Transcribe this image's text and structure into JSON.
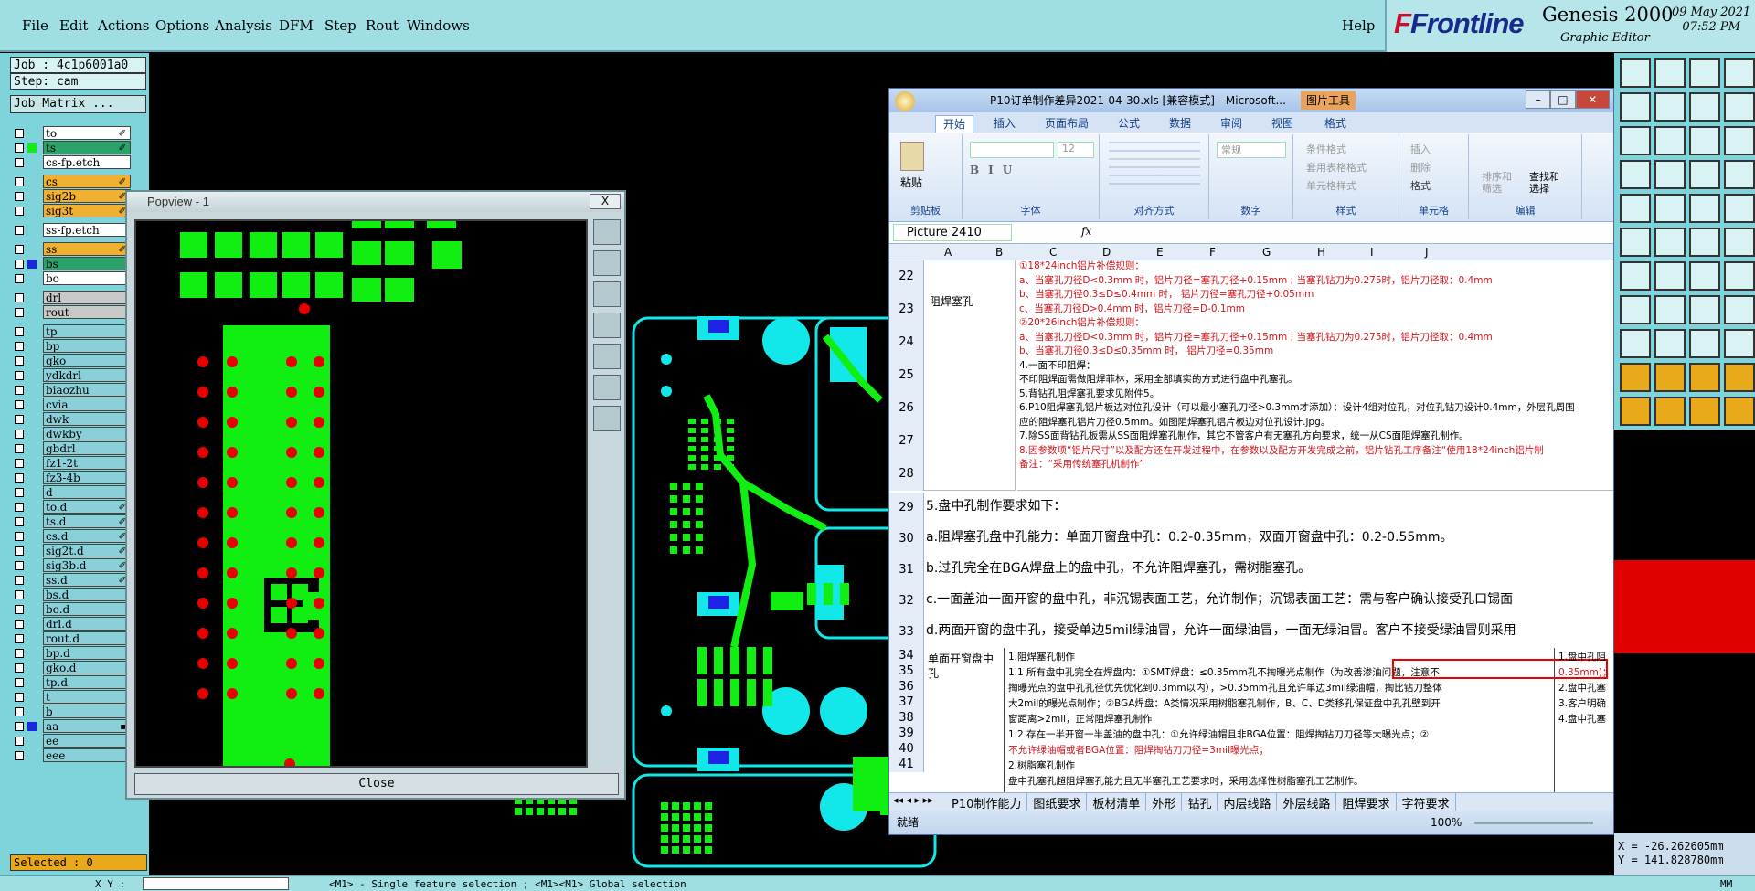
{
  "menu": {
    "items": [
      "File",
      "Edit",
      "Actions",
      "Options",
      "Analysis",
      "DFM",
      "Step",
      "Rout",
      "Windows"
    ],
    "help": "Help"
  },
  "brand": {
    "logo": "Frontline",
    "product": "Genesis 2000",
    "subtitle": "Graphic Editor",
    "date": "09 May 2021",
    "time": "07:52 PM"
  },
  "job": {
    "job_label": "Job : 4c1p6001a0",
    "step_label": "Step: cam",
    "matrix_button": "Job Matrix ..."
  },
  "layers": [
    {
      "name": "to",
      "color": "#ffffff",
      "swatch": "",
      "mark": "✐"
    },
    {
      "name": "ts",
      "color": "#2aa36a",
      "swatch": "#11ee11",
      "mark": "✐"
    },
    {
      "name": "cs-fp.etch",
      "color": "#ffffff",
      "swatch": "",
      "mark": ""
    },
    {
      "name": "cs",
      "color": "#f0b030",
      "swatch": "",
      "mark": "✐"
    },
    {
      "name": "sig2b",
      "color": "#f0b030",
      "swatch": "",
      "mark": "✐"
    },
    {
      "name": "sig3t",
      "color": "#f0b030",
      "swatch": "",
      "mark": "✐"
    },
    {
      "name": "ss-fp.etch",
      "color": "#ffffff",
      "swatch": "",
      "mark": ""
    },
    {
      "name": "ss",
      "color": "#f0b030",
      "swatch": "",
      "mark": "✐"
    },
    {
      "name": "bs",
      "color": "#2aa36a",
      "swatch": "#1a2ad8",
      "mark": ""
    },
    {
      "name": "bo",
      "color": "#ffffff",
      "swatch": "",
      "mark": ""
    },
    {
      "name": "drl",
      "color": "#c8c8c8",
      "swatch": "",
      "mark": ""
    },
    {
      "name": "rout",
      "color": "#c8c8c8",
      "swatch": "",
      "mark": ""
    },
    {
      "name": "tp",
      "color": "#8ad0d8",
      "swatch": "",
      "mark": ""
    },
    {
      "name": "bp",
      "color": "#8ad0d8",
      "swatch": "",
      "mark": ""
    },
    {
      "name": "gko",
      "color": "#8ad0d8",
      "swatch": "",
      "mark": ""
    },
    {
      "name": "ydkdrl",
      "color": "#8ad0d8",
      "swatch": "",
      "mark": ""
    },
    {
      "name": "biaozhu",
      "color": "#8ad0d8",
      "swatch": "",
      "mark": ""
    },
    {
      "name": "cvia",
      "color": "#8ad0d8",
      "swatch": "",
      "mark": ""
    },
    {
      "name": "dwk",
      "color": "#8ad0d8",
      "swatch": "",
      "mark": ""
    },
    {
      "name": "dwkby",
      "color": "#8ad0d8",
      "swatch": "",
      "mark": ""
    },
    {
      "name": "gbdrl",
      "color": "#8ad0d8",
      "swatch": "",
      "mark": ""
    },
    {
      "name": "fz1-2t",
      "color": "#8ad0d8",
      "swatch": "",
      "mark": ""
    },
    {
      "name": "fz3-4b",
      "color": "#8ad0d8",
      "swatch": "",
      "mark": ""
    },
    {
      "name": "d",
      "color": "#8ad0d8",
      "swatch": "",
      "mark": ""
    },
    {
      "name": "to.d",
      "color": "#8ad0d8",
      "swatch": "",
      "mark": "✐"
    },
    {
      "name": "ts.d",
      "color": "#8ad0d8",
      "swatch": "",
      "mark": "✐"
    },
    {
      "name": "cs.d",
      "color": "#8ad0d8",
      "swatch": "",
      "mark": "✐"
    },
    {
      "name": "sig2t.d",
      "color": "#8ad0d8",
      "swatch": "",
      "mark": "✐"
    },
    {
      "name": "sig3b.d",
      "color": "#8ad0d8",
      "swatch": "",
      "mark": "✐"
    },
    {
      "name": "ss.d",
      "color": "#8ad0d8",
      "swatch": "",
      "mark": "✐"
    },
    {
      "name": "bs.d",
      "color": "#8ad0d8",
      "swatch": "",
      "mark": ""
    },
    {
      "name": "bo.d",
      "color": "#8ad0d8",
      "swatch": "",
      "mark": ""
    },
    {
      "name": "drl.d",
      "color": "#8ad0d8",
      "swatch": "",
      "mark": ""
    },
    {
      "name": "rout.d",
      "color": "#8ad0d8",
      "swatch": "",
      "mark": ""
    },
    {
      "name": "bp.d",
      "color": "#8ad0d8",
      "swatch": "",
      "mark": ""
    },
    {
      "name": "gko.d",
      "color": "#8ad0d8",
      "swatch": "",
      "mark": ""
    },
    {
      "name": "tp.d",
      "color": "#8ad0d8",
      "swatch": "",
      "mark": ""
    },
    {
      "name": "t",
      "color": "#8ad0d8",
      "swatch": "",
      "mark": ""
    },
    {
      "name": "b",
      "color": "#8ad0d8",
      "swatch": "",
      "mark": ""
    },
    {
      "name": "aa",
      "color": "#8ad0d8",
      "swatch": "#1a2ad8",
      "mark": "▪"
    },
    {
      "name": "ee",
      "color": "#8ad0d8",
      "swatch": "",
      "mark": ""
    },
    {
      "name": "eee",
      "color": "#8ad0d8",
      "swatch": "",
      "mark": ""
    }
  ],
  "selected": "Selected : 0",
  "popview": {
    "title": "Popview - 1",
    "close_x": "X",
    "close_button": "Close"
  },
  "excel": {
    "title": "P10订单制作差异2021-04-30.xls  [兼容模式] - Microsoft...",
    "picture_tools": "图片工具",
    "tabs": [
      "开始",
      "插入",
      "页面布局",
      "公式",
      "数据",
      "审阅",
      "视图",
      "格式"
    ],
    "ribbon_groups": [
      "剪贴板",
      "字体",
      "对齐方式",
      "数字",
      "样式",
      "单元格",
      "编辑"
    ],
    "ribbon_items": {
      "paste": "粘贴",
      "font_size": "12",
      "number_format": "常规",
      "cond_format": "条件格式",
      "table_format": "套用表格格式",
      "cell_style": "单元格样式",
      "insert": "插入",
      "delete": "删除",
      "format": "格式",
      "sort": "排序和\n筛选",
      "find": "查找和\n选择"
    },
    "name_box": "Picture 2410",
    "fx": "fx",
    "columns": [
      "A",
      "B",
      "C",
      "D",
      "E",
      "F",
      "G",
      "H",
      "I",
      "J"
    ],
    "rows": [
      "22",
      "23",
      "24",
      "25",
      "26",
      "27",
      "28",
      "29",
      "30",
      "31",
      "32",
      "33",
      "34",
      "35",
      "36",
      "37",
      "38",
      "39",
      "40",
      "41"
    ],
    "cell_b22": "阻焊塞孔",
    "block1": [
      {
        "t": "①18*24inch铝片补偿规则：",
        "red": true
      },
      {
        "t": "a、当塞孔刀径D<0.3mm 时，铝片刀径=塞孔刀径+0.15mm ; 当塞孔钻刀为0.275时，铝片刀径取：0.4mm",
        "red": true
      },
      {
        "t": "b、当塞孔刀径0.3≤D≤0.4mm 时， 铝片刀径=塞孔刀径+0.05mm",
        "red": true
      },
      {
        "t": "c、当塞孔刀径D>0.4mm 时，铝片刀径=D-0.1mm",
        "red": true
      },
      {
        "t": "②20*26inch铝片补偿规则：",
        "red": true
      },
      {
        "t": "a、当塞孔刀径D<0.3mm 时，铝片刀径=塞孔刀径+0.15mm ; 当塞孔钻刀为0.275时，铝片刀径取：0.4mm",
        "red": true
      },
      {
        "t": "b、当塞孔刀径0.3≤D≤0.35mm 时， 铝片刀径=0.35mm",
        "red": true
      },
      {
        "t": "4.一面不印阻焊：",
        "red": false
      },
      {
        "t": "不印阻焊面需做阻焊菲林，采用全部填实的方式进行盘中孔塞孔。",
        "red": false
      },
      {
        "t": "5.背钻孔阻焊塞孔要求见附件5。",
        "red": false
      },
      {
        "t": "6.P10阻焊塞孔铝片板边对位孔设计（可以最小塞孔刀径>0.3mm才添加）：设计4组对位孔，对位孔钻刀设计0.4mm，外层孔周围",
        "red": false
      },
      {
        "t": "应的阻焊塞孔铝片刀径0.5mm。如图阻焊塞孔铝片板边对位孔设计.jpg。",
        "red": false
      },
      {
        "t": "7.除SS面背钻孔板需从SS面阻焊塞孔制作，其它不管客户有无塞孔方向要求，统一从CS面阻焊塞孔制作。",
        "red": false
      },
      {
        "t": "8.因参数项“铝片尺寸”以及配方还在开发过程中，在参数以及配方开发完成之前，铝片钻孔工序备注“使用18*24inch铝片制",
        "red": true
      },
      {
        "t": "备注：“采用传统塞孔机制作”",
        "red": true
      }
    ],
    "img_lines": [
      "5.盘中孔制作要求如下：",
      "a.阻焊塞孔盘中孔能力：单面开窗盘中孔：0.2-0.35mm，双面开窗盘中孔：0.2-0.55mm。",
      "b.过孔完全在BGA焊盘上的盘中孔，不允许阻焊塞孔，需树脂塞孔。",
      "c.一面盖油一面开窗的盘中孔，非沉锡表面工艺，允许制作；沉锡表面工艺：需与客户确认接受孔口锡面",
      "d.两面开窗的盘中孔，接受单边5mil绿油冒，允许一面绿油冒，一面无绿油冒。客户不接受绿油冒则采用"
    ],
    "cell_b34": "单面开窗盘中孔",
    "block2": [
      {
        "t": "1.阻焊塞孔制作",
        "red": false
      },
      {
        "t": "1.1 所有盘中孔完全在焊盘内：①SMT焊盘：≤0.35mm孔不掏曝光点制作（为改善渗油问题，注意不",
        "red": false
      },
      {
        "t": "掏曝光点的盘中孔孔径优先优化到0.3mm以内），>0.35mm孔且允许单边3mil绿油帽，掏比钻刀整体",
        "red": false
      },
      {
        "t": "大2mil的曝光点制作；②BGA焊盘：A类情况采用树脂塞孔制作，B、C、D类移孔保证盘中孔孔壁到开",
        "red": false
      },
      {
        "t": "窗距离>2mil，正常阻焊塞孔制作",
        "red": false
      },
      {
        "t": "1.2 存在一半开窗一半盖油的盘中孔：①允许绿油帽且非BGA位置：阻焊掏钻刀刀径等大曝光点；②",
        "red": false
      },
      {
        "t": "不允许绿油帽或者BGA位置：阻焊掏钻刀刀径=3mil曝光点；",
        "red": true
      },
      {
        "t": "2.树脂塞孔制作",
        "red": false
      },
      {
        "t": "盘中孔塞孔超阻焊塞孔能力且无半塞孔工艺要求时，采用选择性树脂塞孔工艺制作。",
        "red": false
      }
    ],
    "col_j": [
      "1.盘中孔阻",
      "0.35mm)；",
      "2.盘中孔塞",
      "3.客户明确",
      "4.盘中孔塞"
    ],
    "sheet_tabs": [
      "P10制作能力",
      "图纸要求",
      "板材清单",
      "外形",
      "钻孔",
      "内层线路",
      "外层线路",
      "阻焊要求",
      "字符要求"
    ],
    "status_ready": "就绪",
    "zoom": "100%"
  },
  "coords": {
    "x": "X = -26.262605mm",
    "y": "Y = 141.828780mm"
  },
  "statusbar": {
    "left": "X Y :",
    "hint": "<M1> - Single feature selection ; <M1><M1> Global selection",
    "mm": "MM"
  },
  "colors": {
    "pad_green": "#11ee11",
    "cyan": "#12e8ea",
    "blue": "#1e22e6",
    "red_drill": "#e80000",
    "panel": "#7fd4dc"
  }
}
